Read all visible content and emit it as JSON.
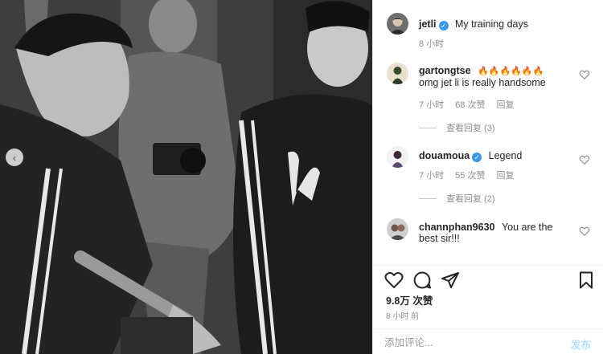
{
  "post": {
    "author": "jetli",
    "caption": "My training days",
    "time": "8 小时",
    "verified": true
  },
  "comments": [
    {
      "username": "gartongtse",
      "line1": "🔥🔥🔥🔥🔥🔥",
      "line2": "omg jet li is really handsome",
      "time": "7 小时",
      "likes": "68 次赞",
      "reply": "回复",
      "view_replies": "查看回复 (3)",
      "verified": false
    },
    {
      "username": "douamoua",
      "line1": "Legend",
      "time": "7 小时",
      "likes": "55 次赞",
      "reply": "回复",
      "view_replies": "查看回复 (2)",
      "verified": true
    },
    {
      "username": "channphan9630",
      "line1": "You are the",
      "line2": "best sir!!!",
      "verified": false
    }
  ],
  "actions": {
    "like_icon": "heart-icon",
    "comment_icon": "comment-bubble-icon",
    "share_icon": "paper-plane-icon",
    "save_icon": "bookmark-icon"
  },
  "likes_count": "9.8万 次赞",
  "post_time": "8 小时 前",
  "add_comment": {
    "placeholder": "添加评论...",
    "post_label": "发布"
  },
  "colors": {
    "verified_blue": "#3897f0",
    "meta_gray": "#8e8e8e",
    "text": "#262626"
  }
}
